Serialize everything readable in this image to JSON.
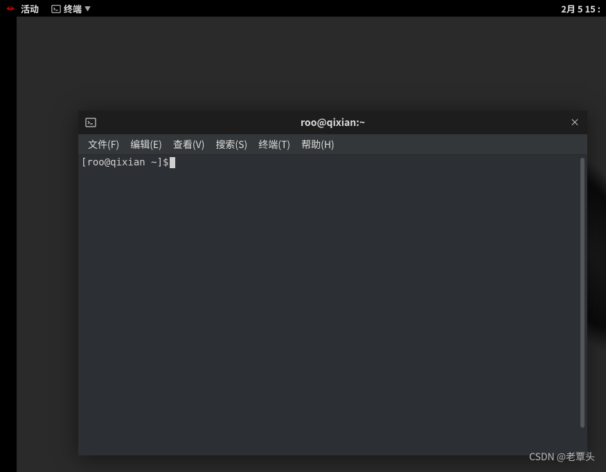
{
  "topbar": {
    "activities": "活动",
    "app_name": "终端",
    "datetime": "2月 5 15 :"
  },
  "window": {
    "title": "roo@qixian:~",
    "close_glyph": "×"
  },
  "menubar": {
    "items": [
      {
        "label": "文件(F)"
      },
      {
        "label": "编辑(E)"
      },
      {
        "label": "查看(V)"
      },
      {
        "label": "搜索(S)"
      },
      {
        "label": "终端(T)"
      },
      {
        "label": "帮助(H)"
      }
    ]
  },
  "terminal": {
    "prompt": "[roo@qixian ~]$ "
  },
  "watermark": "CSDN @老覃头"
}
